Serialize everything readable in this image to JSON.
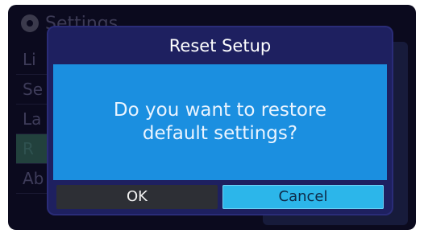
{
  "background": {
    "header_title": "Settings",
    "menu_items": [
      "Li",
      "Se",
      "La",
      "R",
      "Ab"
    ],
    "selected_index": 3
  },
  "dialog": {
    "title": "Reset Setup",
    "message_line1": "Do you want to restore",
    "message_line2": "default settings?",
    "ok_label": "OK",
    "cancel_label": "Cancel",
    "focused_button": "Cancel"
  },
  "colors": {
    "dialog_frame": "#1e2060",
    "dialog_body": "#1b8fe0",
    "focused_button": "#2cb6ea",
    "unfocused_button": "#2d2f35"
  },
  "icons": {
    "header_icon": "gear-icon"
  }
}
